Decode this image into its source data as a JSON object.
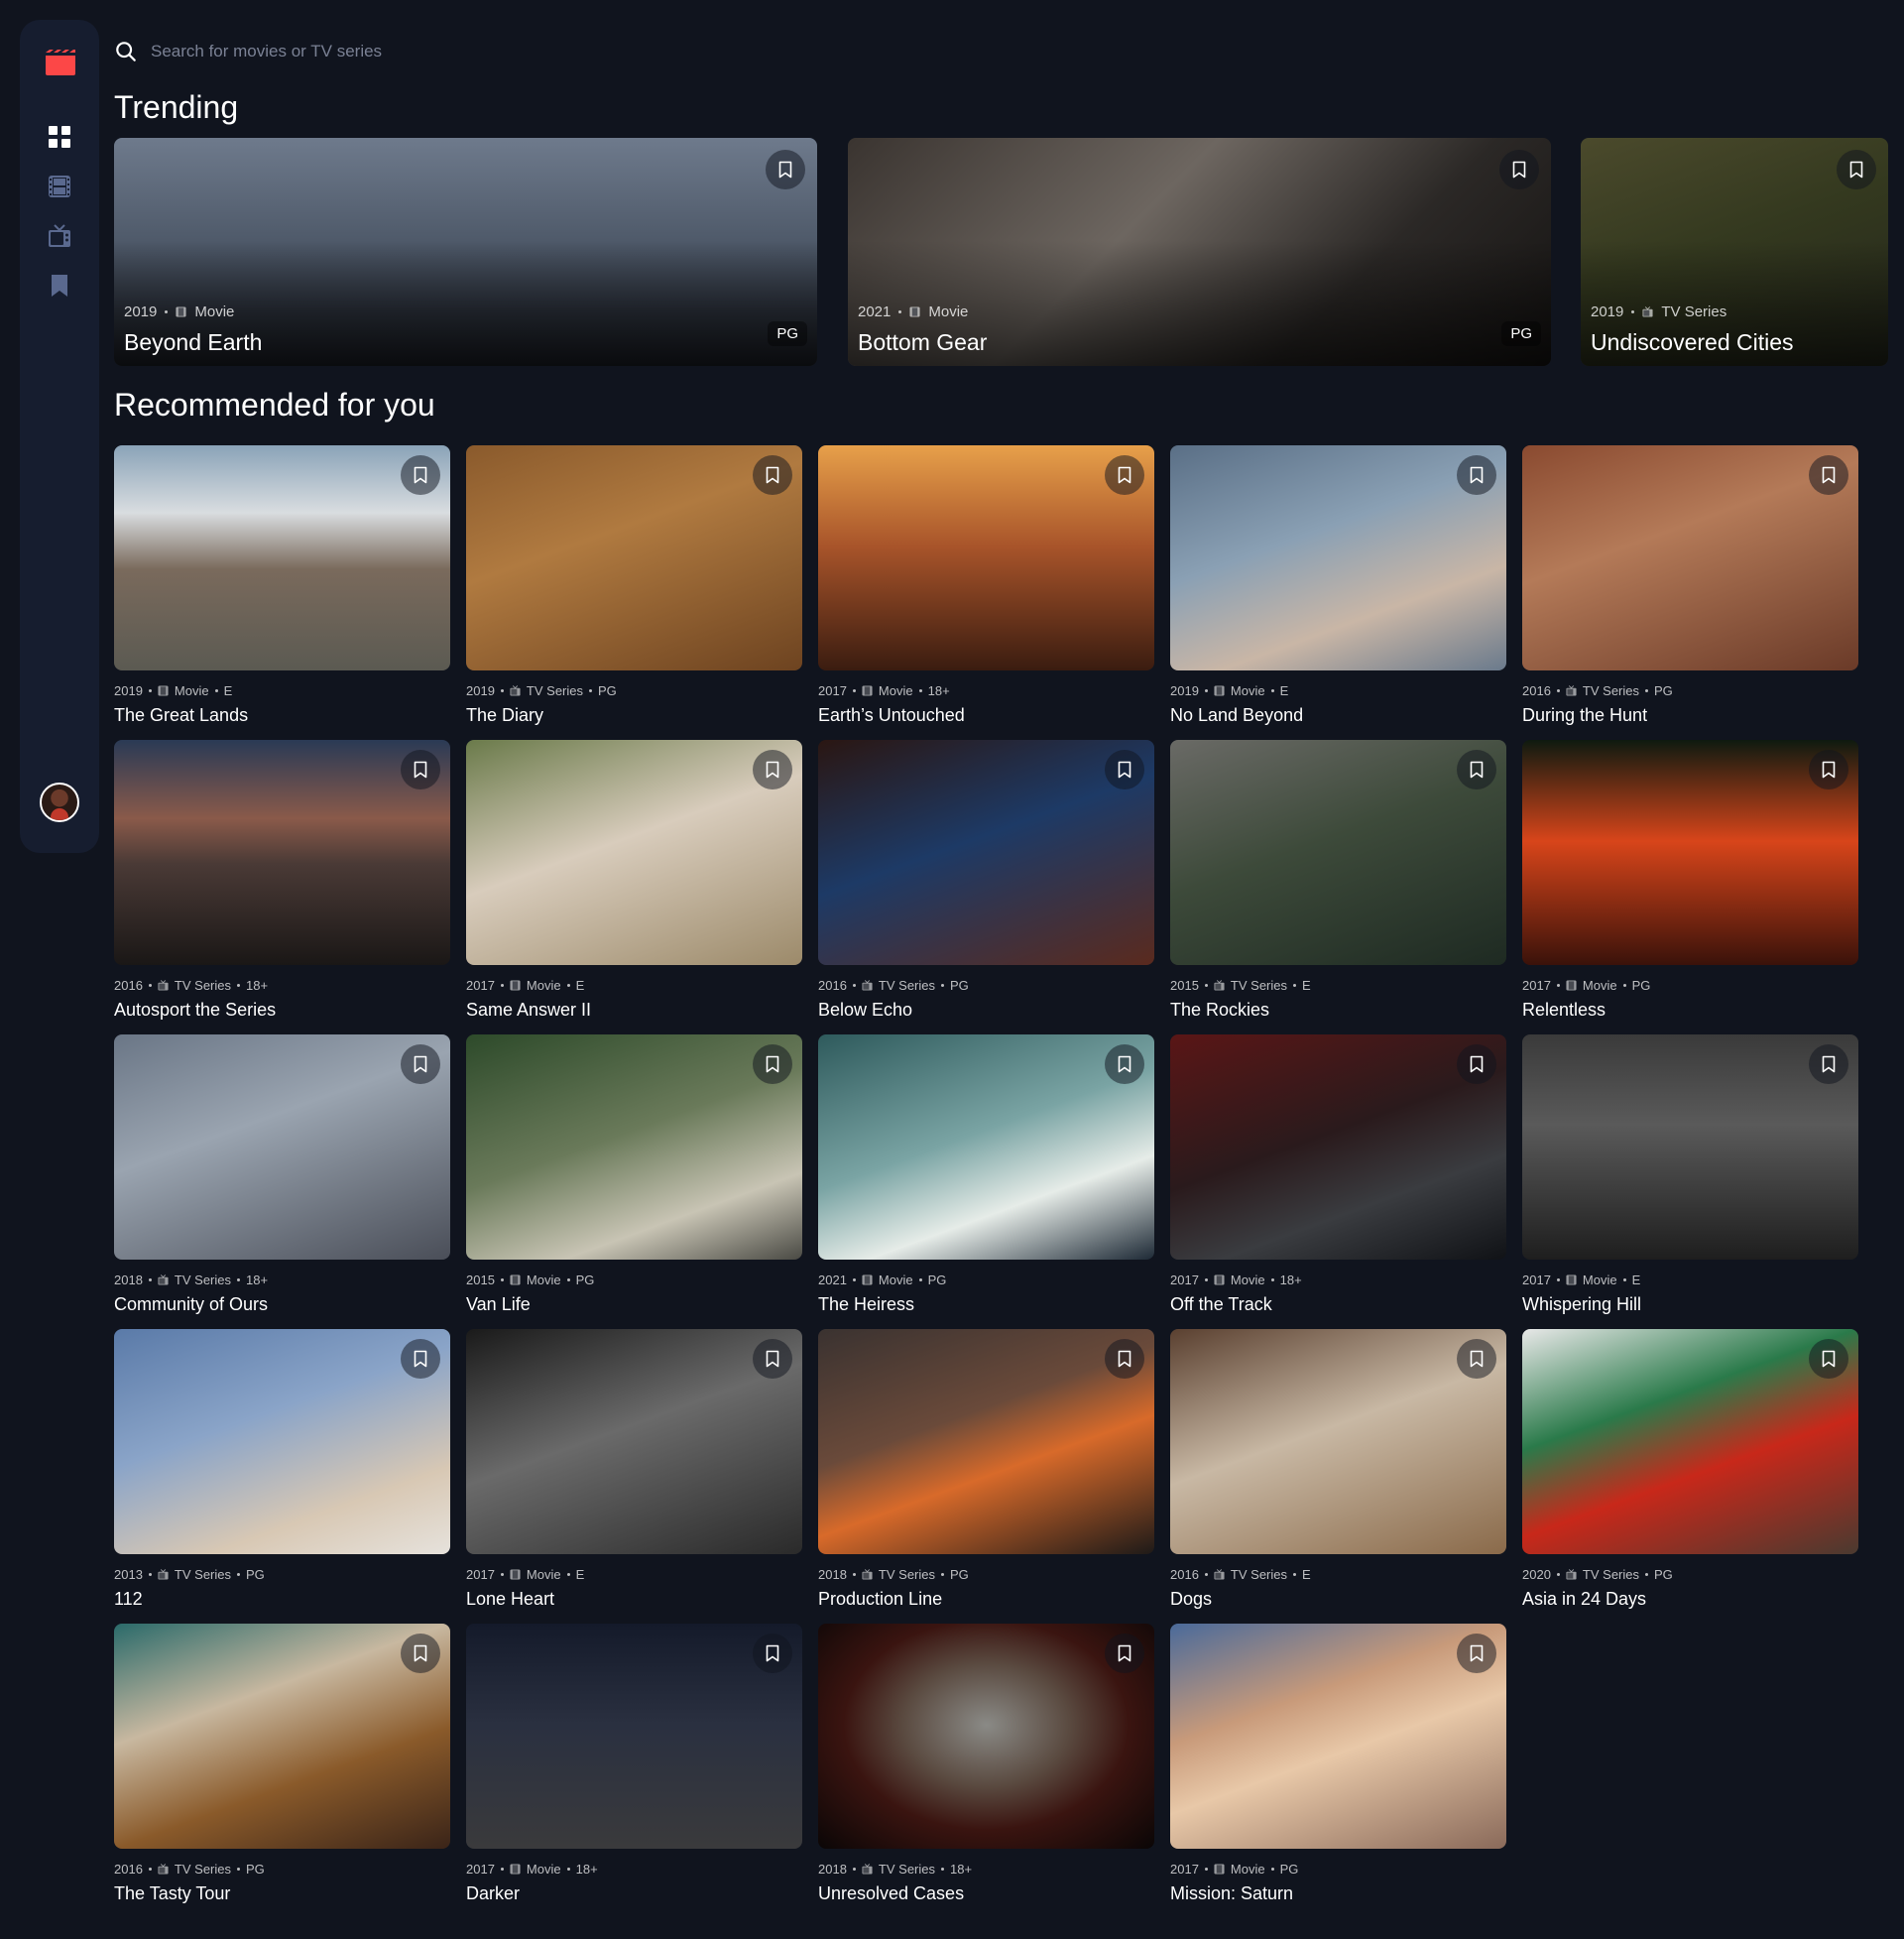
{
  "search": {
    "placeholder": "Search for movies or TV series"
  },
  "sections": {
    "trending": "Trending",
    "recommended": "Recommended for you"
  },
  "trending": [
    {
      "year": "2019",
      "category": "Movie",
      "rating": "PG",
      "title": "Beyond Earth",
      "bg": "linear-gradient(180deg,#6e7a8c 0%,#4f5a6a 45%,#2f3540 75%,#1d2128 100%)"
    },
    {
      "year": "2021",
      "category": "Movie",
      "rating": "PG",
      "title": "Bottom Gear",
      "bg": "linear-gradient(135deg,#3a3430 0%,#6d6660 40%,#2b2826 70%,#151312 100%)"
    },
    {
      "year": "2019",
      "category": "TV Series",
      "rating": "",
      "title": "Undiscovered Cities",
      "bg": "linear-gradient(160deg,#4b4a2c 0%,#34391f 45%,#22251a 100%)"
    }
  ],
  "recommended": [
    {
      "year": "2019",
      "category": "Movie",
      "rating": "E",
      "title": "The Great Lands",
      "bg": "linear-gradient(180deg,#8aa3b8 0%,#d9dde0 30%,#7a6a5c 55%,#5b5a52 100%)"
    },
    {
      "year": "2019",
      "category": "TV Series",
      "rating": "PG",
      "title": "The Diary",
      "bg": "linear-gradient(160deg,#8a5a2c 0%,#b07a40 40%,#6d4320 100%)"
    },
    {
      "year": "2017",
      "category": "Movie",
      "rating": "18+",
      "title": "Earth’s Untouched",
      "bg": "linear-gradient(180deg,#e7a04a 0%,#a8542a 45%,#3a1c10 100%)"
    },
    {
      "year": "2019",
      "category": "Movie",
      "rating": "E",
      "title": "No Land Beyond",
      "bg": "linear-gradient(160deg,#5a6f86 0%,#8aa0b4 40%,#c9b6a6 70%,#6a7a8c 100%)"
    },
    {
      "year": "2016",
      "category": "TV Series",
      "rating": "PG",
      "title": "During the Hunt",
      "bg": "linear-gradient(160deg,#8a4a30 0%,#b47a58 40%,#6a3a28 100%)"
    },
    {
      "year": "2016",
      "category": "TV Series",
      "rating": "18+",
      "title": "Autosport the Series",
      "bg": "linear-gradient(180deg,#2a3a55 0%,#8a5a4a 35%,#4a3a36 55%,#1a1716 100%)"
    },
    {
      "year": "2017",
      "category": "Movie",
      "rating": "E",
      "title": "Same Answer II",
      "bg": "linear-gradient(160deg,#6a7a4a 0%,#d8ccbc 45%,#9c8a6a 100%)"
    },
    {
      "year": "2016",
      "category": "TV Series",
      "rating": "PG",
      "title": "Below Echo",
      "bg": "linear-gradient(160deg,#2a1612 0%,#1d3a66 45%,#5a2a1e 100%)"
    },
    {
      "year": "2015",
      "category": "TV Series",
      "rating": "E",
      "title": "The Rockies",
      "bg": "linear-gradient(160deg,#6a6a66 0%,#3d4a3a 45%,#1e2a22 100%)"
    },
    {
      "year": "2017",
      "category": "Movie",
      "rating": "PG",
      "title": "Relentless",
      "bg": "linear-gradient(180deg,#0e1a10 0%,#d8451a 45%,#3a120a 100%)"
    },
    {
      "year": "2018",
      "category": "TV Series",
      "rating": "18+",
      "title": "Community of Ours",
      "bg": "linear-gradient(160deg,#6a7686 0%,#9aa4b0 40%,#4a4e58 100%)"
    },
    {
      "year": "2015",
      "category": "Movie",
      "rating": "PG",
      "title": "Van Life",
      "bg": "linear-gradient(160deg,#2d4a2a 0%,#6a7a5a 45%,#c8c4b4 75%,#4a4a44 100%)"
    },
    {
      "year": "2021",
      "category": "Movie",
      "rating": "PG",
      "title": "The Heiress",
      "bg": "linear-gradient(160deg,#2e5a5c 0%,#7aa4a4 45%,#e6ece8 70%,#1e2a36 100%)"
    },
    {
      "year": "2017",
      "category": "Movie",
      "rating": "18+",
      "title": "Off the Track",
      "bg": "linear-gradient(160deg,#5a1616 0%,#2a1a1c 45%,#3a3c40 70%,#101216 100%)"
    },
    {
      "year": "2017",
      "category": "Movie",
      "rating": "E",
      "title": "Whispering Hill",
      "bg": "linear-gradient(180deg,#3a3a3a 0%,#5a5a5a 40%,#1e1e1e 100%)"
    },
    {
      "year": "2013",
      "category": "TV Series",
      "rating": "PG",
      "title": "112",
      "bg": "linear-gradient(160deg,#5a7aa8 0%,#8aa4c8 40%,#d8c8b4 75%,#e6e2dc 100%)"
    },
    {
      "year": "2017",
      "category": "Movie",
      "rating": "E",
      "title": "Lone Heart",
      "bg": "linear-gradient(160deg,#1a1a1a 0%,#6a6a6a 45%,#2a2a2a 100%)"
    },
    {
      "year": "2018",
      "category": "TV Series",
      "rating": "PG",
      "title": "Production Line",
      "bg": "linear-gradient(160deg,#3a3230 0%,#6a4a3a 40%,#d86a2a 60%,#1e1a18 100%)"
    },
    {
      "year": "2016",
      "category": "TV Series",
      "rating": "E",
      "title": "Dogs",
      "bg": "linear-gradient(160deg,#5a4030 0%,#c8b8a4 45%,#8a6a4a 100%)"
    },
    {
      "year": "2020",
      "category": "TV Series",
      "rating": "PG",
      "title": "Asia in 24 Days",
      "bg": "linear-gradient(160deg,#e8e8e8 0%,#2a7a4a 35%,#c8281a 60%,#4a3a30 100%)"
    },
    {
      "year": "2016",
      "category": "TV Series",
      "rating": "PG",
      "title": "The Tasty Tour",
      "bg": "linear-gradient(160deg,#2a6a6a 0%,#c8b8a0 35%,#8a5a2a 65%,#3a2418 100%)"
    },
    {
      "year": "2017",
      "category": "Movie",
      "rating": "18+",
      "title": "Darker",
      "bg": "linear-gradient(180deg,#141a2a 0%,#2a3040 45%,#3a3a3c 100%)"
    },
    {
      "year": "2018",
      "category": "TV Series",
      "rating": "18+",
      "title": "Unresolved Cases",
      "bg": "radial-gradient(ellipse at 50% 45%,#8a8a86 0%,#5a4a40 35%,#3a1410 60%,#0a0606 100%)"
    },
    {
      "year": "2017",
      "category": "Movie",
      "rating": "PG",
      "title": "Mission: Saturn",
      "bg": "linear-gradient(160deg,#4a6a9a 0%,#c89a7a 35%,#e8c8a8 55%,#8a6a5a 100%)"
    }
  ],
  "colors": {
    "accent": "#fc4747",
    "background": "#10141e",
    "surface": "#161d2f",
    "muted": "#5a698f"
  }
}
